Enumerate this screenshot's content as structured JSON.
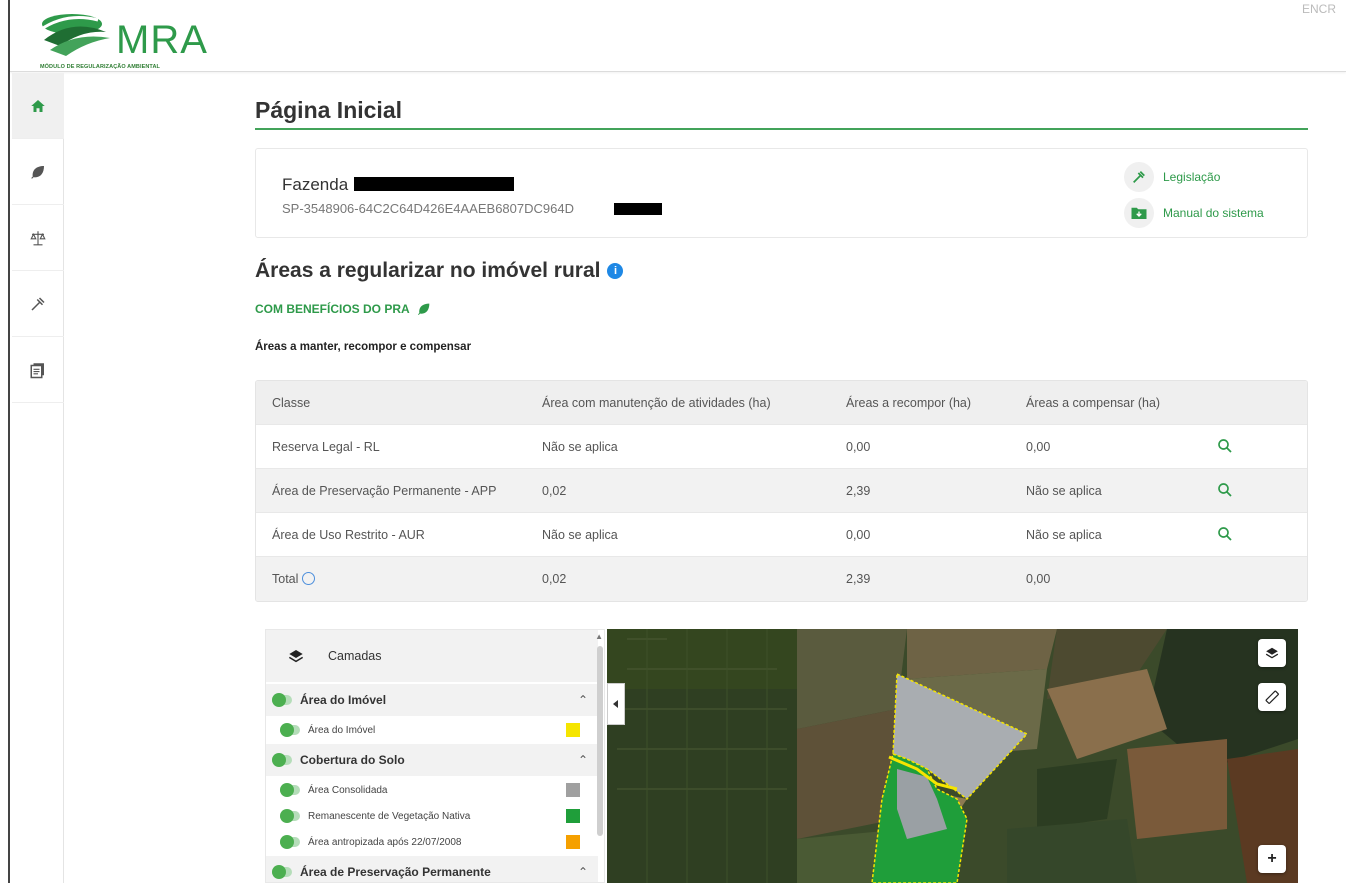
{
  "header": {
    "logo_text": "MRA",
    "logo_subtitle": "MÓDULO DE REGULARIZAÇÃO AMBIENTAL",
    "right_text": "ENCR"
  },
  "sidebar": {
    "items": [
      {
        "name": "home",
        "icon": "home-icon"
      },
      {
        "name": "leaf",
        "icon": "leaf-icon"
      },
      {
        "name": "legislation",
        "icon": "scale-icon"
      },
      {
        "name": "tools",
        "icon": "gavel-icon"
      },
      {
        "name": "manual",
        "icon": "book-icon"
      }
    ]
  },
  "page": {
    "title": "Página Inicial"
  },
  "farm": {
    "name": "Fazenda",
    "code": "SP-3548906-64C2C64D426E4AAEB6807DC964D"
  },
  "links": {
    "legislation": "Legislação",
    "manual": "Manual do sistema"
  },
  "areas": {
    "title": "Áreas a regularizar no imóvel rural",
    "info": "i",
    "benefits_label": "COM BENEFÍCIOS DO PRA",
    "subtitle": "Áreas a manter, recompor e compensar"
  },
  "table": {
    "headers": [
      "Classe",
      "Área com manutenção de atividades (ha)",
      "Áreas a recompor (ha)",
      "Áreas a compensar (ha)"
    ],
    "rows": [
      [
        "Reserva Legal - RL",
        "Não se aplica",
        "0,00",
        "0,00"
      ],
      [
        "Área de Preservação Permanente - APP",
        "0,02",
        "2,39",
        "Não se aplica"
      ],
      [
        "Área de Uso Restrito - AUR",
        "Não se aplica",
        "0,00",
        "Não se aplica"
      ]
    ],
    "total": [
      "Total",
      "0,02",
      "2,39",
      "0,00"
    ]
  },
  "layers": {
    "title": "Camadas",
    "groups": [
      {
        "label": "Área do Imóvel",
        "items": [
          {
            "label": "Área do Imóvel",
            "color": "#f5e500"
          }
        ]
      },
      {
        "label": "Cobertura do Solo",
        "items": [
          {
            "label": "Área Consolidada",
            "color": "#a0a0a0"
          },
          {
            "label": "Remanescente de Vegetação Nativa",
            "color": "#1f9e3a"
          },
          {
            "label": "Área antropizada após 22/07/2008",
            "color": "#f5a000"
          }
        ]
      },
      {
        "label": "Área de Preservação Permanente",
        "items": []
      }
    ]
  },
  "map": {
    "zoom_in": "+"
  },
  "colors": {
    "accent": "#2e9a4a",
    "line": "#43a35a"
  }
}
